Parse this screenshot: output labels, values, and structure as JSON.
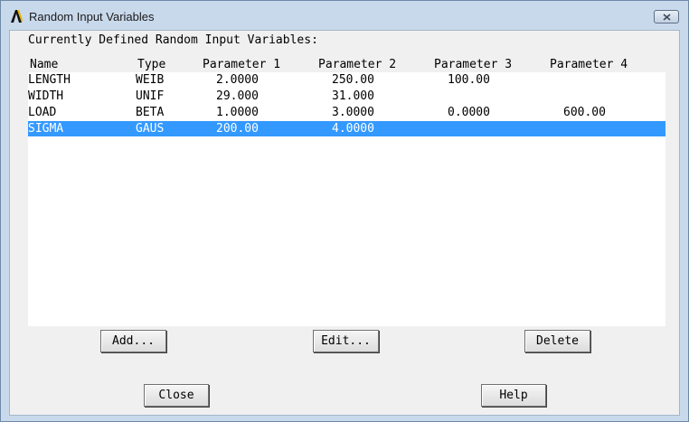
{
  "window": {
    "title": "Random Input Variables"
  },
  "heading": "Currently Defined Random Input Variables:",
  "columns": [
    "Name",
    "Type",
    "Parameter 1",
    "Parameter 2",
    "Parameter 3",
    "Parameter 4"
  ],
  "rows": [
    {
      "name": "LENGTH",
      "type": "WEIB",
      "p1": "2.0000",
      "p2": "250.00",
      "p3": "100.00",
      "p4": ""
    },
    {
      "name": "WIDTH",
      "type": "UNIF",
      "p1": "29.000",
      "p2": "31.000",
      "p3": "",
      "p4": ""
    },
    {
      "name": "LOAD",
      "type": "BETA",
      "p1": "1.0000",
      "p2": "3.0000",
      "p3": "0.0000",
      "p4": "600.00"
    },
    {
      "name": "SIGMA",
      "type": "GAUS",
      "p1": "200.00",
      "p2": "4.0000",
      "p3": "",
      "p4": ""
    }
  ],
  "selected_row": "SIGMA",
  "buttons": {
    "add": "Add...",
    "edit": "Edit...",
    "delete": "Delete",
    "close": "Close",
    "help": "Help"
  },
  "colors": {
    "selection": "#3399ff",
    "frame": "#c9d9ec"
  },
  "icons": {
    "app": "ansys-logo-icon",
    "close": "close-icon"
  }
}
